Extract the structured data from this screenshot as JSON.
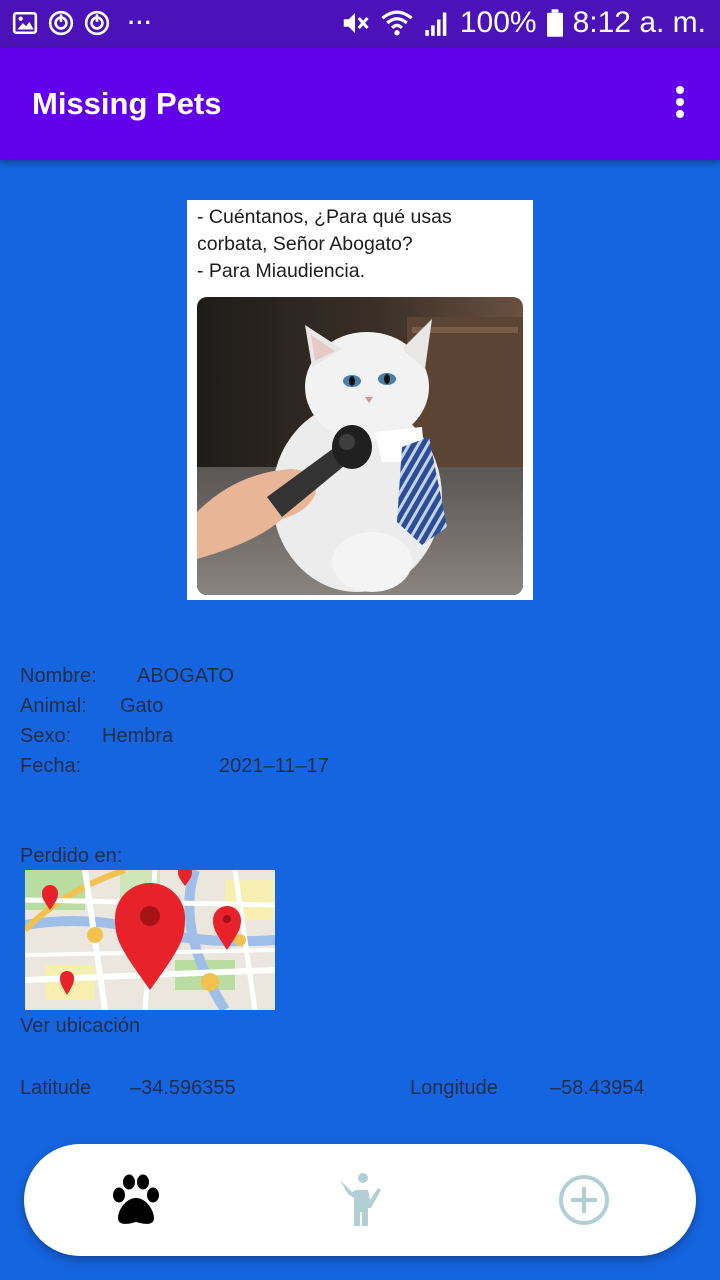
{
  "status_bar": {
    "battery": "100%",
    "time": "8:12 a. m.",
    "more_label": "···"
  },
  "app_bar": {
    "title": "Missing Pets"
  },
  "meme": {
    "line1": "- Cuéntanos, ¿Para qué usas",
    "line2": "corbata, Señor Abogato?",
    "line3": "- Para Miaudiencia."
  },
  "pet": {
    "name_label": "Nombre:",
    "name": "ABOGATO",
    "animal_label": "Animal:",
    "animal": "Gato",
    "sex_label": "Sexo:",
    "sex": "Hembra",
    "date_label": "Fecha:",
    "date": "2021–11–17"
  },
  "location": {
    "lost_at_label": "Perdido en:",
    "view_location_label": "Ver ubicación",
    "latitude_label": "Latitude",
    "latitude": "–34.596355",
    "longitude_label": "Longitude",
    "longitude": "–58.43954"
  },
  "bottom_nav": {
    "items": [
      {
        "icon": "paw-icon",
        "active": true,
        "color": "#000000"
      },
      {
        "icon": "person-icon",
        "active": false,
        "color": "#b3cfd6"
      },
      {
        "icon": "add-circle-icon",
        "active": false,
        "color": "#b3cfd6"
      }
    ]
  },
  "colors": {
    "status_bar": "#4a12b8",
    "app_bar": "#6200ea",
    "background": "#1565e0",
    "text": "#1f2d4a"
  }
}
